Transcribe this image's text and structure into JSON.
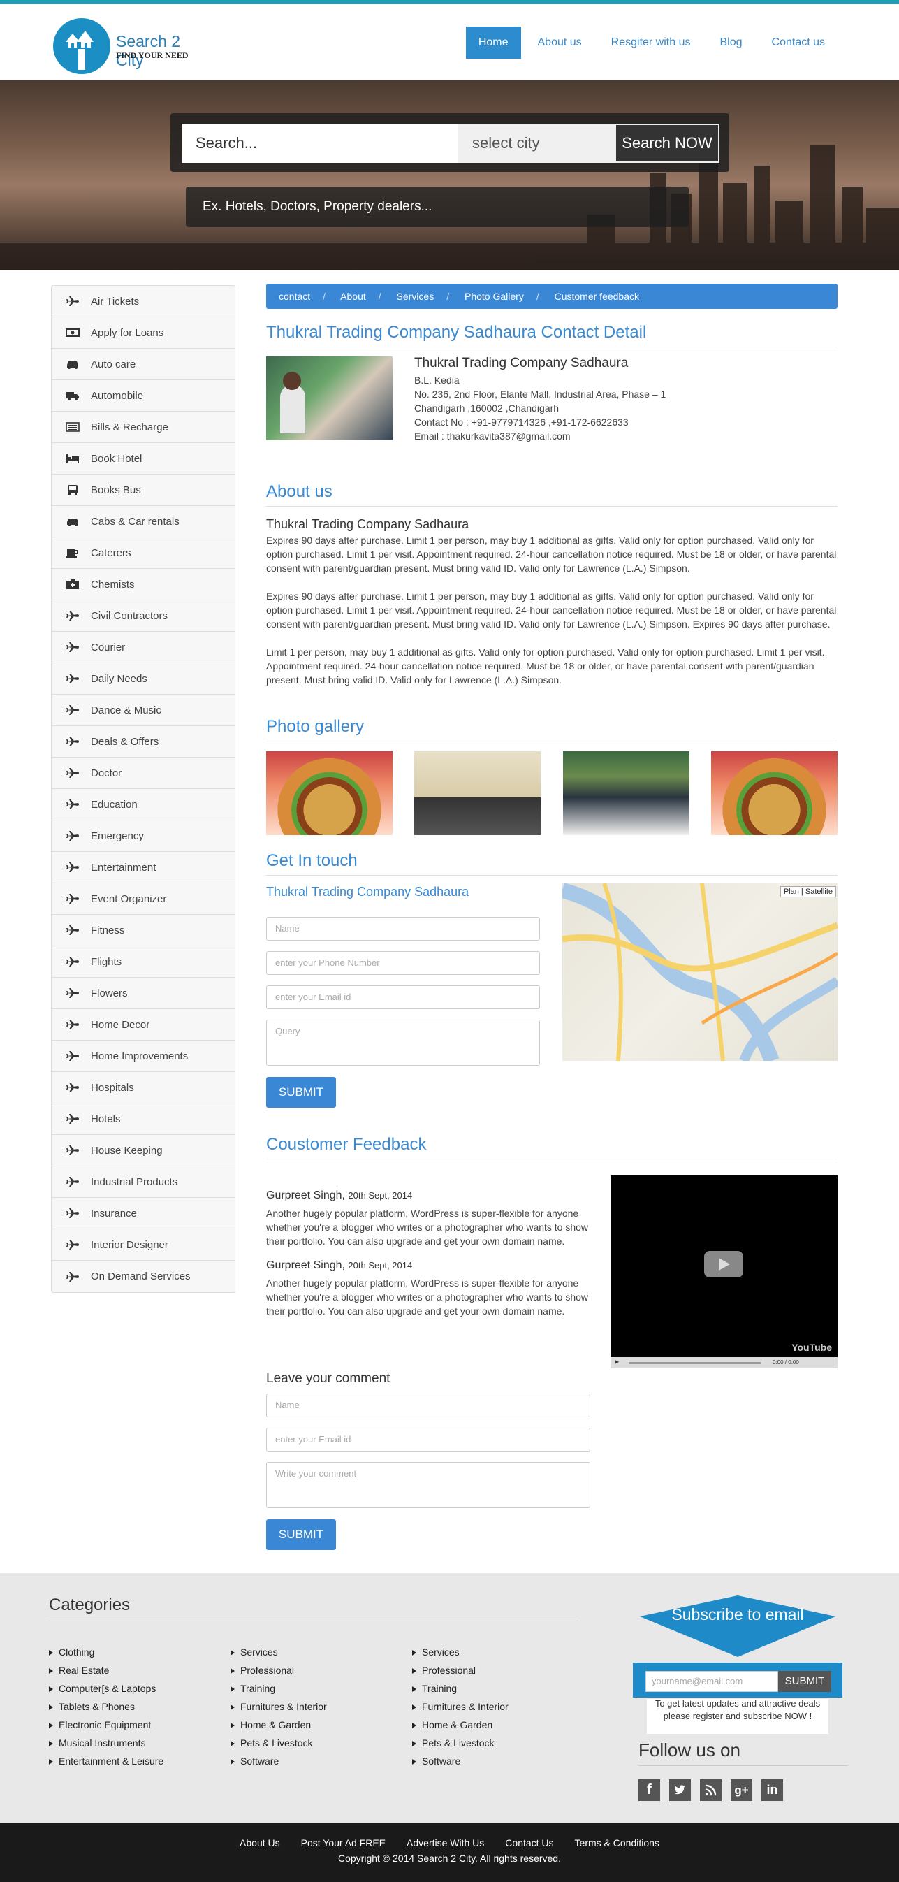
{
  "brand": {
    "name": "Search 2 City",
    "tagline": "FIND YOUR NEED"
  },
  "nav": {
    "items": [
      "Home",
      "About us",
      "Resgiter with us",
      "Blog",
      "Contact us"
    ],
    "active": "Home"
  },
  "search": {
    "placeholder": "Search...",
    "city": "select city",
    "button": "Search NOW",
    "hint": "Ex. Hotels, Doctors, Property dealers..."
  },
  "sidebar": {
    "items": [
      {
        "label": "Air Tickets",
        "icon": "plane-icon"
      },
      {
        "label": "Apply for Loans",
        "icon": "money-icon"
      },
      {
        "label": "Auto care",
        "icon": "car-icon"
      },
      {
        "label": "Automobile",
        "icon": "truck-icon"
      },
      {
        "label": "Bills & Recharge",
        "icon": "list-icon"
      },
      {
        "label": "Book Hotel",
        "icon": "bed-icon"
      },
      {
        "label": "Books Bus",
        "icon": "bus-icon"
      },
      {
        "label": "Cabs & Car rentals",
        "icon": "car-icon"
      },
      {
        "label": "Caterers",
        "icon": "cup-icon"
      },
      {
        "label": "Chemists",
        "icon": "medkit-icon"
      },
      {
        "label": "Civil Contractors",
        "icon": "plane-icon"
      },
      {
        "label": "Courier",
        "icon": "plane-icon"
      },
      {
        "label": "Daily Needs",
        "icon": "plane-icon"
      },
      {
        "label": "Dance & Music",
        "icon": "plane-icon"
      },
      {
        "label": "Deals & Offers",
        "icon": "plane-icon"
      },
      {
        "label": "Doctor",
        "icon": "plane-icon"
      },
      {
        "label": "Education",
        "icon": "plane-icon"
      },
      {
        "label": "Emergency",
        "icon": "plane-icon"
      },
      {
        "label": "Entertainment",
        "icon": "plane-icon"
      },
      {
        "label": "Event Organizer",
        "icon": "plane-icon"
      },
      {
        "label": "Fitness",
        "icon": "plane-icon"
      },
      {
        "label": "Flights",
        "icon": "plane-icon"
      },
      {
        "label": "Flowers",
        "icon": "plane-icon"
      },
      {
        "label": "Home Decor",
        "icon": "plane-icon"
      },
      {
        "label": "Home Improvements",
        "icon": "plane-icon"
      },
      {
        "label": "Hospitals",
        "icon": "plane-icon"
      },
      {
        "label": "Hotels",
        "icon": "plane-icon"
      },
      {
        "label": "House Keeping",
        "icon": "plane-icon"
      },
      {
        "label": "Industrial Products",
        "icon": "plane-icon"
      },
      {
        "label": "Insurance",
        "icon": "plane-icon"
      },
      {
        "label": "Interior Designer",
        "icon": "plane-icon"
      },
      {
        "label": "On Demand Services",
        "icon": "plane-icon"
      }
    ]
  },
  "breadcrumb": [
    "contact",
    "About",
    "Services",
    "Photo Gallery",
    "Customer feedback"
  ],
  "contact": {
    "heading": "Thukral Trading Company Sadhaura Contact Detail",
    "name": "Thukral Trading Company Sadhaura",
    "person": "B.L. Kedia",
    "address1": "No. 236, 2nd Floor, Elante Mall, Industrial Area, Phase – 1",
    "address2": "Chandigarh ,160002 ,Chandigarh",
    "phone": "Contact No : +91-9779714326 ,+91-172-6622633",
    "email": "Email : thakurkavita387@gmail.com"
  },
  "about": {
    "heading": "About us",
    "subheading": "Thukral Trading Company Sadhaura",
    "p1": "Expires 90 days after purchase. Limit 1 per person, may buy 1 additional as gifts. Valid only for option purchased. Valid only for option purchased. Limit 1 per visit. Appointment required. 24-hour cancellation notice required. Must be 18 or older, or have parental consent with parent/guardian present. Must bring valid ID. Valid only for Lawrence (L.A.) Simpson.",
    "p2": "Expires 90 days after purchase. Limit 1 per person, may buy 1 additional as gifts. Valid only for option purchased. Valid only for option purchased. Limit 1 per visit. Appointment required. 24-hour cancellation notice required. Must be 18 or older, or have parental consent with parent/guardian present. Must bring valid ID. Valid only for Lawrence (L.A.) Simpson. Expires 90 days after purchase.",
    "p3": "Limit 1 per person, may buy 1 additional as gifts. Valid only for option purchased. Valid only for option purchased. Limit 1 per visit. Appointment required. 24-hour cancellation notice required. Must be 18 or older, or have parental consent with parent/guardian present. Must bring valid ID. Valid only for Lawrence (L.A.) Simpson."
  },
  "gallery": {
    "heading": "Photo gallery"
  },
  "touch": {
    "heading": "Get In touch",
    "company": "Thukral Trading Company Sadhaura",
    "name_ph": "Name",
    "phone_ph": "enter your Phone Number",
    "email_ph": "enter your Email id",
    "query_ph": "Query",
    "submit": "SUBMIT",
    "map_plan": "Plan",
    "map_sat": "Satellite"
  },
  "feedback": {
    "heading": "Coustomer Feedback",
    "entries": [
      {
        "name": "Gurpreet Singh,",
        "date": "20th Sept, 2014",
        "text": "Another hugely popular platform, WordPress is super-flexible for anyone whether you're a blogger who writes or a photographer who wants to show their portfolio. You can also upgrade and get your own domain name."
      },
      {
        "name": "Gurpreet Singh,",
        "date": "20th Sept, 2014",
        "text": "Another hugely popular platform, WordPress is super-flexible for anyone whether you're a blogger who writes or a photographer who wants to show their portfolio. You can also upgrade and get your own domain name."
      }
    ],
    "video_time": "0:00 / 0:00",
    "video_brand": "YouTube"
  },
  "comment": {
    "heading": "Leave your comment",
    "name_ph": "Name",
    "email_ph": "enter your Email id",
    "comment_ph": "Write your comment",
    "submit": "SUBMIT"
  },
  "footer": {
    "categories_heading": "Categories",
    "col1": [
      "Clothing",
      "Real Estate",
      "Computer[s & Laptops",
      "Tablets & Phones",
      "Electronic Equipment",
      "Musical Instruments",
      "Entertainment & Leisure"
    ],
    "col2": [
      "Services",
      "Professional",
      "Training",
      "Furnitures & Interior",
      "Home & Garden",
      "Pets & Livestock",
      "Software"
    ],
    "col3": [
      "Services",
      "Professional",
      "Training",
      "Furnitures & Interior",
      "Home & Garden",
      "Pets & Livestock",
      "Software"
    ],
    "subscribe_heading": "Subscribe to email",
    "subscribe_ph": "yourname@email.com",
    "subscribe_btn": "SUBMIT",
    "subscribe_text": "To get latest updates and attractive deals please register and subscribe NOW !",
    "follow_heading": "Follow us on",
    "social": [
      "facebook-icon",
      "twitter-icon",
      "rss-icon",
      "google-plus-icon",
      "linkedin-icon"
    ],
    "links": [
      "About Us",
      "Post Your Ad FREE",
      "Advertise With Us",
      "Contact Us",
      "Terms & Conditions"
    ],
    "copyright": "Copyright © 2014 Search 2 City. All rights reserved."
  },
  "colors": {
    "accent": "#3a87d5",
    "topstripe": "#1e9eb0",
    "footer_bg": "#e8e8e8"
  }
}
